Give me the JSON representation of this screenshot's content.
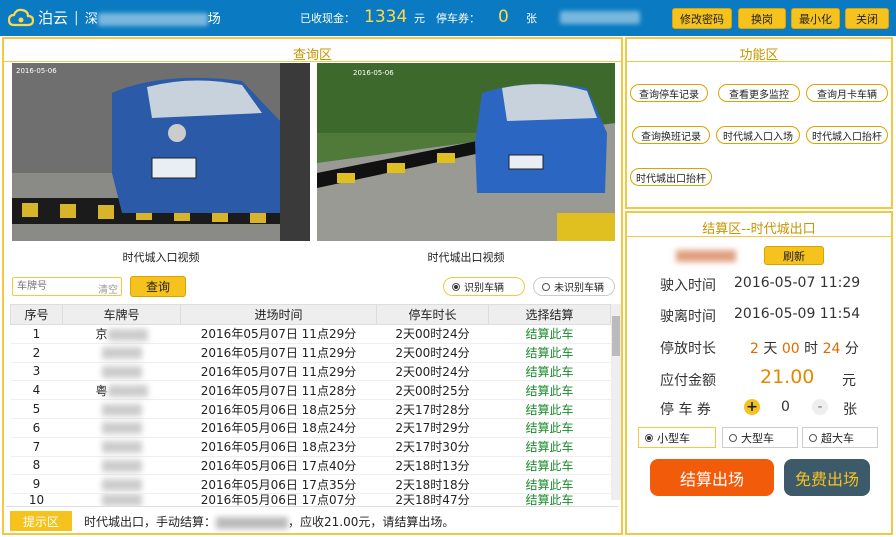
{
  "brand": {
    "logo_text": "泊云",
    "sep": "|",
    "parking_prefix": "深",
    "parking_suffix": "场"
  },
  "stats": {
    "cash_label": "已收现金：",
    "cash_value": "1334",
    "cash_unit": "元",
    "ticket_label": "停车券：",
    "ticket_value": "0",
    "ticket_unit": "张"
  },
  "top_buttons": {
    "change_pw": "修改密码",
    "shift": "换岗",
    "minimize": "最小化",
    "close": "关闭"
  },
  "query": {
    "title": "查询区",
    "video_left": "时代城入口视频",
    "video_right": "时代城出口视频",
    "cam_left_ts": "2016-05-06",
    "cam_right_ts": "2016-05-06",
    "plate_placeholder": "车牌号",
    "clear": "清空",
    "search": "查询",
    "radio_recognized": "识别车辆",
    "radio_unrecognized": "未识别车辆",
    "columns": [
      "序号",
      "车牌号",
      "进场时间",
      "停车时长",
      "选择结算"
    ],
    "rows": [
      {
        "no": "1",
        "plate": "京",
        "entry": "2016年05月07日 11点29分",
        "duration": "2天00时24分",
        "action": "结算此车"
      },
      {
        "no": "2",
        "plate": "",
        "entry": "2016年05月07日 11点29分",
        "duration": "2天00时24分",
        "action": "结算此车"
      },
      {
        "no": "3",
        "plate": "",
        "entry": "2016年05月07日 11点29分",
        "duration": "2天00时24分",
        "action": "结算此车"
      },
      {
        "no": "4",
        "plate": "粤",
        "entry": "2016年05月07日 11点28分",
        "duration": "2天00时25分",
        "action": "结算此车"
      },
      {
        "no": "5",
        "plate": "",
        "entry": "2016年05月06日 18点25分",
        "duration": "2天17时28分",
        "action": "结算此车"
      },
      {
        "no": "6",
        "plate": "",
        "entry": "2016年05月06日 18点24分",
        "duration": "2天17时29分",
        "action": "结算此车"
      },
      {
        "no": "7",
        "plate": "",
        "entry": "2016年05月06日 18点23分",
        "duration": "2天17时30分",
        "action": "结算此车"
      },
      {
        "no": "8",
        "plate": "",
        "entry": "2016年05月06日 17点40分",
        "duration": "2天18时13分",
        "action": "结算此车"
      },
      {
        "no": "9",
        "plate": "",
        "entry": "2016年05月06日 17点35分",
        "duration": "2天18时18分",
        "action": "结算此车"
      },
      {
        "no": "10",
        "plate": "",
        "entry": "2016年05月06日 17点07分",
        "duration": "2天18时47分",
        "action": "结算此车"
      }
    ]
  },
  "hint": {
    "label": "提示区",
    "text": "时代城出口，手动结算：",
    "text_tail": "，应收21.00元，请结算出场。"
  },
  "functions": {
    "title": "功能区",
    "buttons": [
      "查询停车记录",
      "查看更多监控",
      "查询月卡车辆",
      "查询换班记录",
      "时代城入口入场",
      "时代城入口抬杆",
      "时代城出口抬杆"
    ]
  },
  "settle": {
    "title": "结算区--时代城出口",
    "refresh": "刷新",
    "entry_label": "驶入时间",
    "entry_value": "2016-05-07 11:29",
    "exit_label": "驶离时间",
    "exit_value": "2016-05-09 11:54",
    "duration_label": "停放时长",
    "d_days": "2",
    "d_days_unit": "天",
    "d_hours": "00",
    "d_hours_unit": "时",
    "d_mins": "24",
    "d_mins_unit": "分",
    "amount_label": "应付金额",
    "amount_value": "21.00",
    "amount_unit": "元",
    "ticket_label": "停 车 券",
    "ticket_plus": "+",
    "ticket_value": "0",
    "ticket_minus": "-",
    "ticket_unit": "张",
    "vehicle_types": [
      "小型车",
      "大型车",
      "超大车"
    ],
    "pay_button": "结算出场",
    "free_button": "免费出场"
  },
  "colors": {
    "topbar": "#0a7bc2",
    "accent": "#f6c21e",
    "pay": "#f25b0a",
    "free": "#3d5a6a",
    "action_green": "#1a8c2c"
  }
}
